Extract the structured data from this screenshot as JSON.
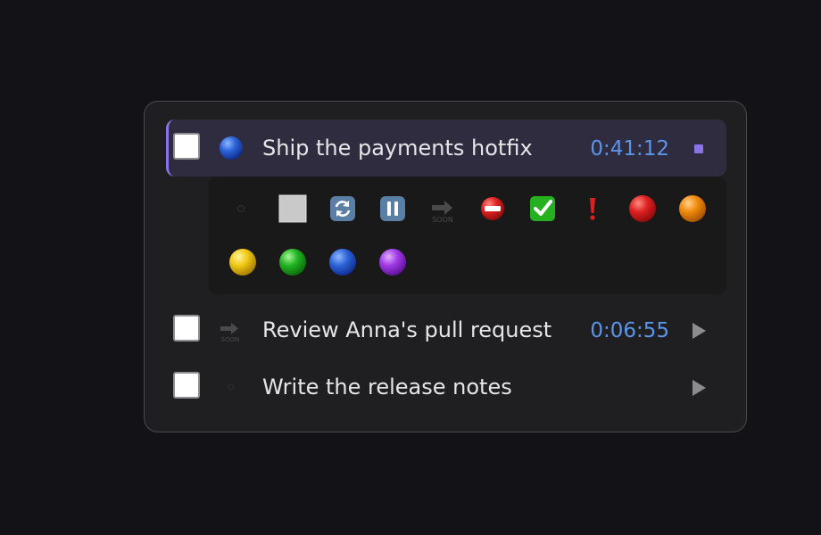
{
  "tasks": [
    {
      "title": "Ship the payments hotfix",
      "timer": "0:41:12",
      "marker_icon": "blue-circle-icon",
      "action_icon": "stop-icon",
      "active": true
    },
    {
      "title": "Review Anna's pull request",
      "timer": "0:06:55",
      "marker_icon": "soon-arrow-icon",
      "marker_text": "SOON",
      "action_icon": "play-icon",
      "active": false
    },
    {
      "title": "Write the release notes",
      "timer": "",
      "marker_icon": "none-icon",
      "action_icon": "play-icon",
      "active": false
    }
  ],
  "marker_picker": {
    "soon_text": "SOON",
    "options": [
      "none-icon",
      "white-square-icon",
      "refresh-icon",
      "pause-icon",
      "soon-arrow-icon",
      "no-entry-icon",
      "check-mark-icon",
      "exclamation-icon",
      "red-circle-icon",
      "orange-circle-icon",
      "yellow-circle-icon",
      "green-circle-icon",
      "blue-circle-icon",
      "purple-circle-icon"
    ]
  },
  "colors": {
    "accent": "#8a72e8",
    "timer": "#5c95e8",
    "panel_background": "#1f1f21",
    "page_background": "#131317"
  }
}
